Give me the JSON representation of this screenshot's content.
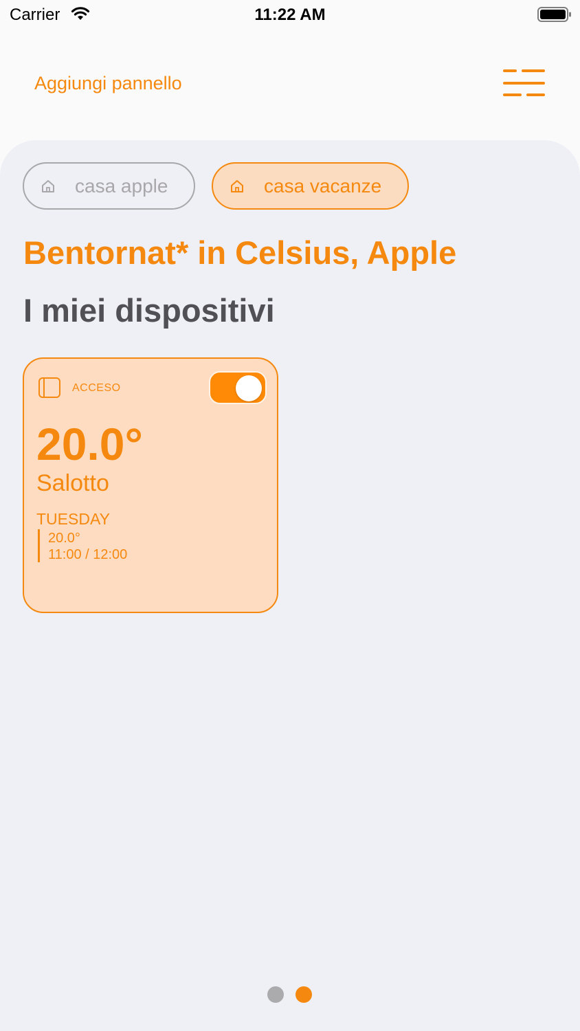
{
  "status_bar": {
    "carrier": "Carrier",
    "time": "11:22 AM",
    "icons": [
      "wifi-icon",
      "battery-icon"
    ]
  },
  "header": {
    "add_panel_label": "Aggiungi pannello",
    "menu_icon": "menu-icon"
  },
  "homes": [
    {
      "label": "casa apple",
      "icon": "home-icon",
      "selected": false
    },
    {
      "label": "casa vacanze",
      "icon": "home-icon",
      "selected": true
    }
  ],
  "welcome_text": "Bentornat* in Celsius, Apple",
  "section_title": "I miei dispositivi",
  "devices": [
    {
      "icon": "device-icon",
      "state": "ACCESO",
      "power_on": true,
      "temperature": "20.0°",
      "room": "Salotto",
      "schedule": {
        "day": "TUESDAY",
        "temperature": "20.0°",
        "time_range": "11:00 / 12:00"
      }
    }
  ],
  "pagination": {
    "total": 2,
    "current": 2
  },
  "colors": {
    "accent": "#f5890f",
    "toggle_on": "#ff8a05",
    "card_bg": "#fedcc2",
    "sheet_bg": "#eef0f5",
    "inactive": "#a8a8ab",
    "title_gray": "#505055"
  }
}
